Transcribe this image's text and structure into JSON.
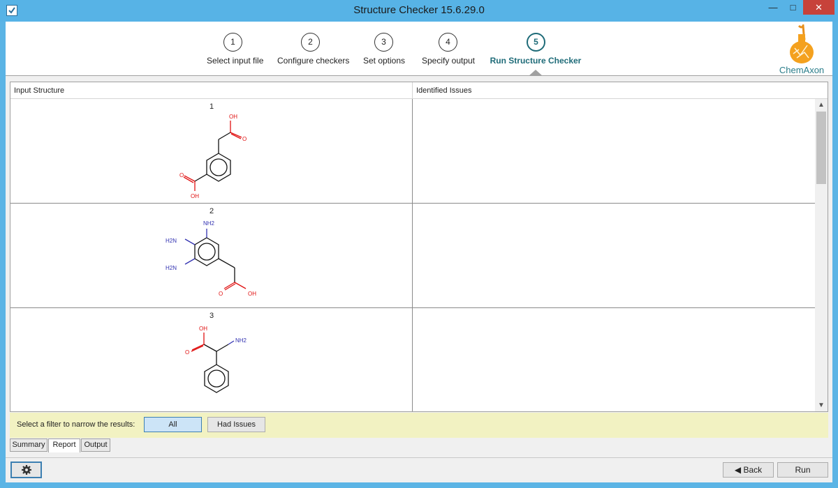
{
  "window": {
    "title": "Structure Checker 15.6.29.0",
    "minimize_label": "—",
    "maximize_label": "□",
    "close_label": "✕"
  },
  "wizard": {
    "steps": [
      {
        "number": "1",
        "label": "Select input file"
      },
      {
        "number": "2",
        "label": "Configure checkers"
      },
      {
        "number": "3",
        "label": "Set options"
      },
      {
        "number": "4",
        "label": "Specify output"
      },
      {
        "number": "5",
        "label": "Run Structure Checker",
        "active": true
      }
    ],
    "logo_text": "ChemAxon"
  },
  "table": {
    "columns": [
      "Input Structure",
      "Identified Issues"
    ],
    "rows": [
      {
        "number": "1",
        "structure_labels": [
          "OH",
          "O",
          "O",
          "OH"
        ],
        "issues": ""
      },
      {
        "number": "2",
        "structure_labels": [
          "NH2",
          "H2N",
          "H2N",
          "O",
          "OH"
        ],
        "issues": ""
      },
      {
        "number": "3",
        "structure_labels": [
          "OH",
          "O",
          "NH2"
        ],
        "issues": ""
      }
    ]
  },
  "filter": {
    "label": "Select a filter to narrow the results:",
    "buttons": [
      "All",
      "Had Issues"
    ],
    "selected": "All"
  },
  "tabs": {
    "items": [
      "Summary",
      "Report",
      "Output"
    ],
    "active": "Report"
  },
  "footer": {
    "back_label": "Back",
    "run_label": "Run",
    "settings_icon": "gear-icon"
  },
  "colors": {
    "titlebar": "#57b3e6",
    "accent": "#1e6b78",
    "oxygen": "#e01010",
    "nitrogen": "#3030b0",
    "filter_bg": "#f2f2c2"
  }
}
